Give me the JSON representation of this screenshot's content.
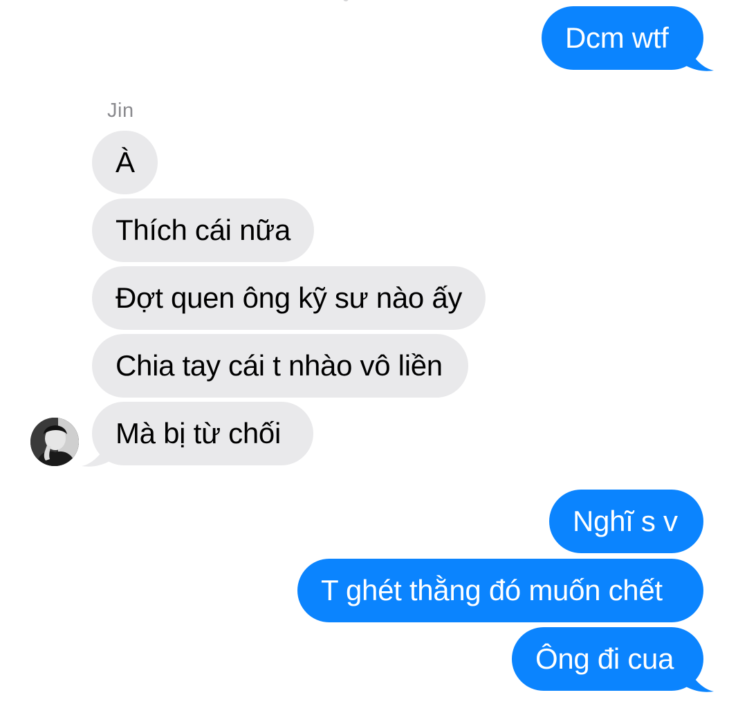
{
  "conversation": {
    "contact_name": "Jin",
    "messages": [
      {
        "direction": "outgoing",
        "text": "Dcm wtf"
      },
      {
        "direction": "incoming",
        "text": "À"
      },
      {
        "direction": "incoming",
        "text": "Thích cái nữa"
      },
      {
        "direction": "incoming",
        "text": "Đợt quen ông kỹ sư nào ấy"
      },
      {
        "direction": "incoming",
        "text": "Chia tay cái t nhào vô liền"
      },
      {
        "direction": "incoming",
        "text": "Mà bị từ chối"
      },
      {
        "direction": "outgoing",
        "text": "Nghĩ s v"
      },
      {
        "direction": "outgoing",
        "text": "T ghét thằng đó muốn chết"
      },
      {
        "direction": "outgoing",
        "text": "Ông đi cua"
      }
    ]
  },
  "colors": {
    "outgoing_bubble": "#0b84fe",
    "incoming_bubble": "#e9e9eb",
    "sender_label": "#8a8a8e"
  },
  "icons": {
    "contact_avatar": "avatar-photo-icon"
  }
}
